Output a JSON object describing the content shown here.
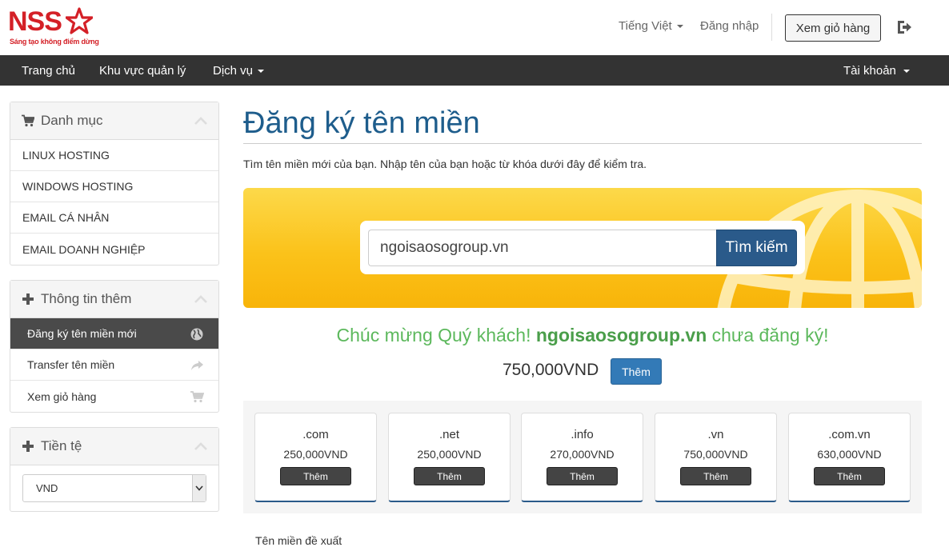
{
  "brand": {
    "logo_text": "NSS",
    "tagline": "Sáng tạo không điểm dừng"
  },
  "topbar": {
    "language": "Tiếng Việt",
    "login": "Đăng nhập",
    "view_cart": "Xem giỏ hàng"
  },
  "navbar": {
    "home": "Trang chủ",
    "client_area": "Khu vực quản lý",
    "services": "Dịch vụ",
    "account": "Tài khoản"
  },
  "sidebar": {
    "categories": {
      "title": "Danh mục",
      "items": [
        "LINUX HOSTING",
        "WINDOWS HOSTING",
        "EMAIL CÁ NHÂN",
        "EMAIL DOANH NGHIỆP"
      ]
    },
    "more_info": {
      "title": "Thông tin thêm",
      "items": [
        "Đăng ký tên miền mới",
        "Transfer tên miền",
        "Xem giỏ hàng"
      ]
    },
    "currency": {
      "title": "Tiền tệ",
      "selected": "VND"
    }
  },
  "main": {
    "title": "Đăng ký tên miền",
    "intro": "Tìm tên miền mới của bạn. Nhập tên của bạn hoặc từ khóa dưới đây để kiểm tra.",
    "search": {
      "value": "ngoisaosogroup.vn",
      "button": "Tìm kiếm"
    },
    "result": {
      "prefix": "Chúc mừng Quý khách!",
      "domain": "ngoisaosogroup.vn",
      "suffix": "chưa đăng ký!",
      "price": "750,000VND",
      "add_button": "Thêm"
    },
    "tlds": [
      {
        "name": ".com",
        "price": "250,000VND",
        "button": "Thêm"
      },
      {
        "name": ".net",
        "price": "250,000VND",
        "button": "Thêm"
      },
      {
        "name": ".info",
        "price": "270,000VND",
        "button": "Thêm"
      },
      {
        "name": ".vn",
        "price": "750,000VND",
        "button": "Thêm"
      },
      {
        "name": ".com.vn",
        "price": "630,000VND",
        "button": "Thêm"
      }
    ],
    "suggested_heading": "Tên miền đề xuất"
  },
  "colors": {
    "brand_red": "#d42027",
    "title_blue": "#1e5d8c",
    "success_green": "#5cb85c",
    "primary_blue": "#337ab7",
    "navbar": "#333333",
    "hero_yellow": "#fbc21a"
  }
}
